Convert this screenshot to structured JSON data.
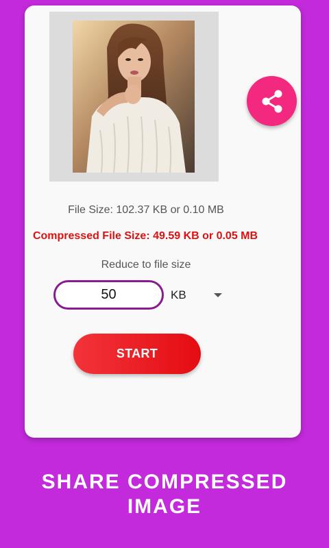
{
  "preview": {
    "image_description_icon": "portrait-photo"
  },
  "share": {
    "icon": "share-icon",
    "color": "#f2297e"
  },
  "info": {
    "file_size": "File Size: 102.37 KB or 0.10 MB",
    "compressed_file_size": "Compressed File Size: 49.59 KB or 0.05 MB",
    "reduce_label": "Reduce to file size"
  },
  "target": {
    "value": "50",
    "unit": "KB"
  },
  "actions": {
    "start_label": "START"
  },
  "caption": {
    "line1": "SHARE COMPRESSED",
    "line2": "IMAGE"
  },
  "colors": {
    "background": "#c22adc",
    "accent_red": "#e40c12",
    "input_border": "#8a1a8f"
  }
}
